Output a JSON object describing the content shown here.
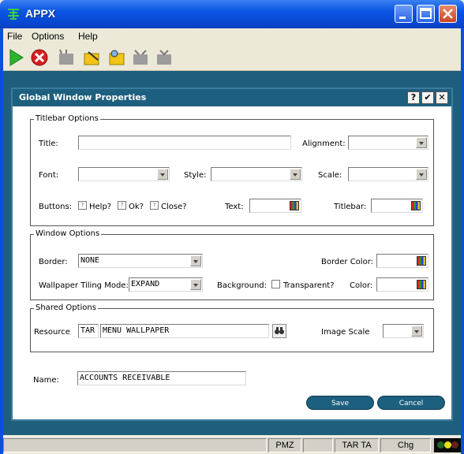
{
  "window": {
    "title": "APPX"
  },
  "menu": [
    "File",
    "Options",
    "Help"
  ],
  "toolbar": [
    "run-icon",
    "cancel-icon",
    "add-icon",
    "edit-icon",
    "search-icon",
    "delete-icon",
    "tv-icon"
  ],
  "dialog": {
    "title": "Global Window Properties",
    "buttons": {
      "help": "?",
      "ok": "✔",
      "close": "✕"
    },
    "titlebar_options": {
      "legend": "Titlebar Options",
      "title_label": "Title:",
      "title_value": "",
      "alignment_label": "Alignment:",
      "font_label": "Font:",
      "style_label": "Style:",
      "scale_label": "Scale:",
      "buttons_label": "Buttons:",
      "help_label": "Help?",
      "ok_label": "Ok?",
      "close_label": "Close?",
      "text_label": "Text:",
      "titlebar_label": "Titlebar:"
    },
    "window_options": {
      "legend": "Window Options",
      "border_label": "Border:",
      "border_value": "NONE",
      "border_color_label": "Border Color:",
      "tiling_label": "Wallpaper Tiling Mode:",
      "tiling_value": "EXPAND",
      "background_label": "Background:",
      "transparent_label": "Transparent?",
      "color_label": "Color:"
    },
    "shared_options": {
      "legend": "Shared Options",
      "resource_label": "Resource",
      "resource_app": "TAR",
      "resource_value": "MENU WALLPAPER",
      "image_scale_label": "Image Scale"
    },
    "name_label": "Name:",
    "name_value": "ACCOUNTS RECEIVABLE",
    "save_label": "Save",
    "cancel_label": "Cancel"
  },
  "status": {
    "pmz": "PMZ",
    "tar": "TAR TA",
    "chg": "Chg"
  }
}
